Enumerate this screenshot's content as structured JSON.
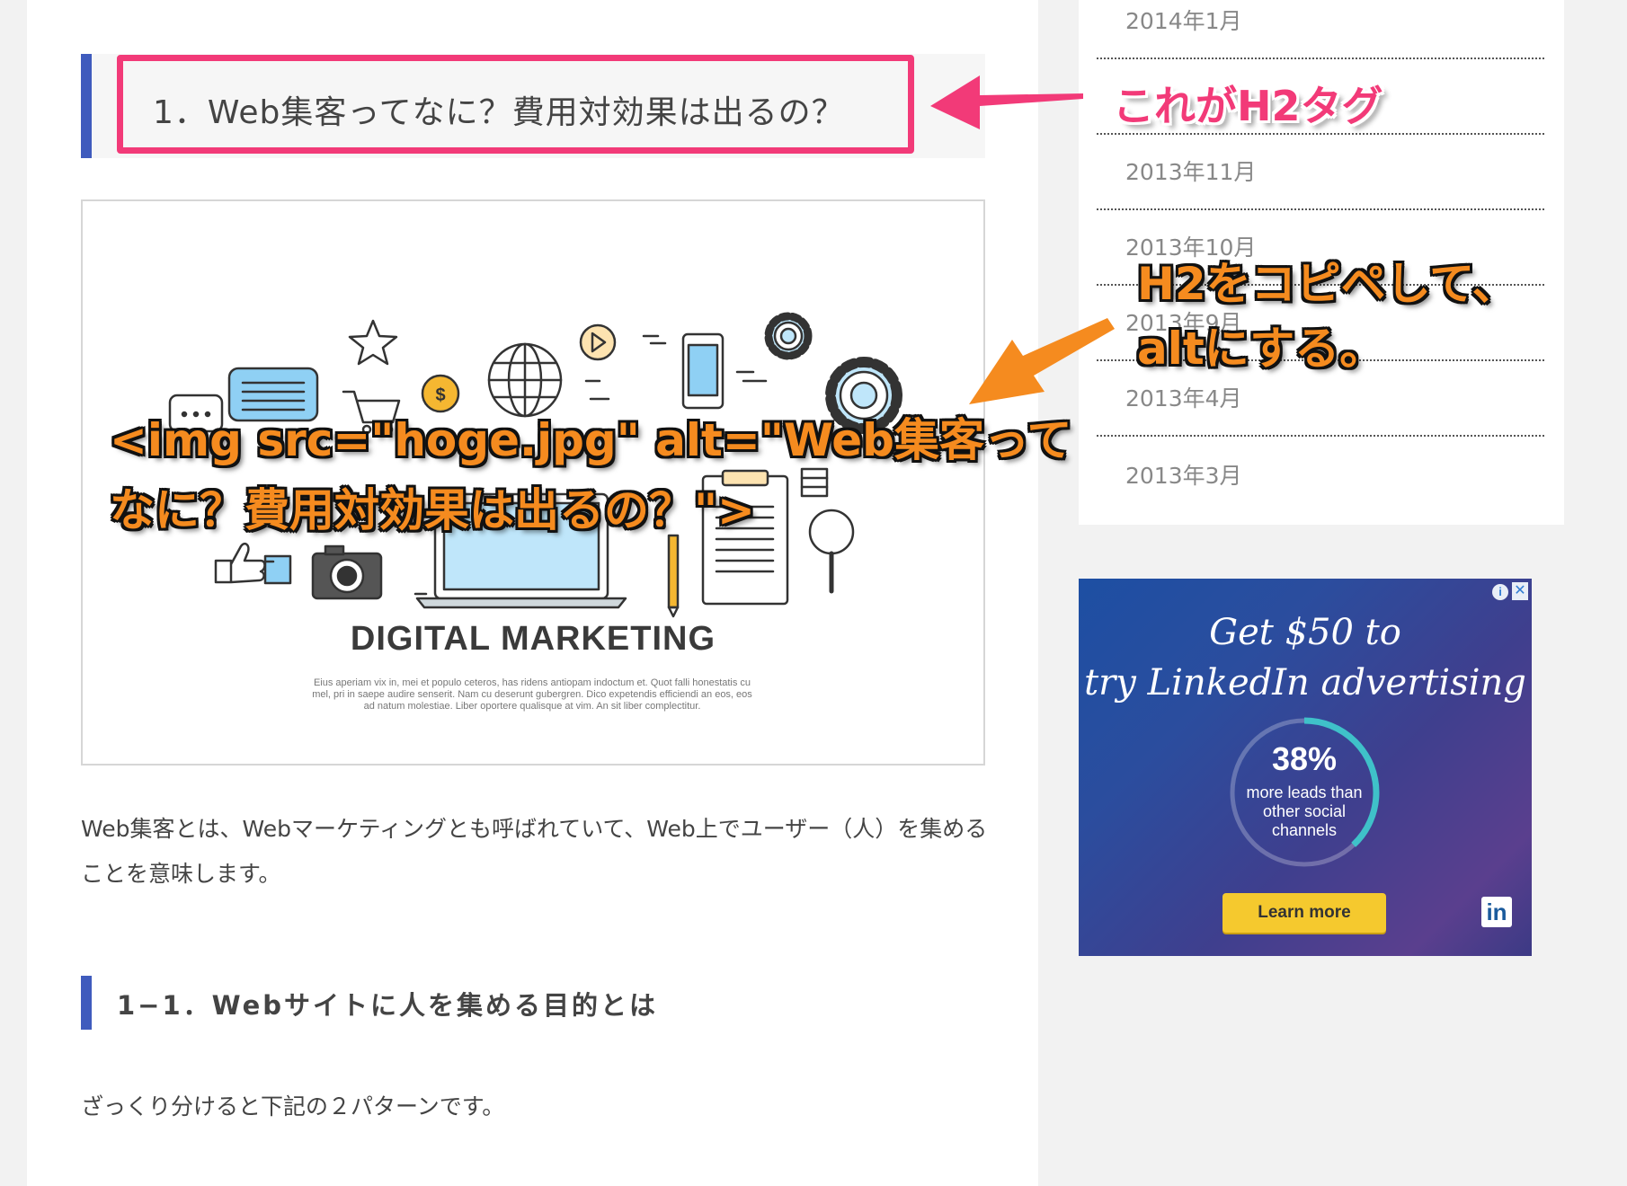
{
  "heading_h2": "1．Web集客ってなに？費用対効果は出るの？",
  "figure": {
    "title": "DIGITAL MARKETING",
    "body": "Eius aperiam vix in, mei et populo ceteros, has ridens antiopam indoctum et. Quot falli honestatis cu mel, pri in saepe audire senserit. Nam cu deserunt gubergren. Dico expetendis efficiendi an eos, eos ad natum molestiae. Liber oportere qualisque at vim. An sit liber complectitur.",
    "coin_symbol": "$"
  },
  "paragraph_1": "Web集客とは、Webマーケティングとも呼ばれていて、Web上でユーザー（人）を集めることを意味します。",
  "heading_h3": "1−1．Webサイトに人を集める目的とは",
  "paragraph_2": "ざっくり分けると下記の２パターンです。",
  "sidebar": {
    "archives": [
      "2014年1月",
      "",
      "2013年11月",
      "2013年10月",
      "2013年9月",
      "2013年4月",
      "2013年3月"
    ]
  },
  "ad": {
    "headline_1": "Get $50 to",
    "headline_2": "try LinkedIn advertising",
    "stat_value": "38%",
    "stat_text": "more leads than other social channels",
    "cta": "Learn more",
    "logo": "in",
    "info": "i",
    "close": "✕"
  },
  "annotations": {
    "h2_tag": "これがH2タグ",
    "instruction_1": "H2をコピペして、",
    "instruction_2": "altにする。",
    "img_code_1": "<img src=\"hoge.jpg\" alt=\"Web集客って",
    "img_code_2": "なに？費用対効果は出るの？\">"
  },
  "colors": {
    "accent_blue": "#3f5bbd",
    "highlight_pink": "#f23a78",
    "annotation_orange": "#f58b1f",
    "cta_yellow": "#f5c92e"
  }
}
